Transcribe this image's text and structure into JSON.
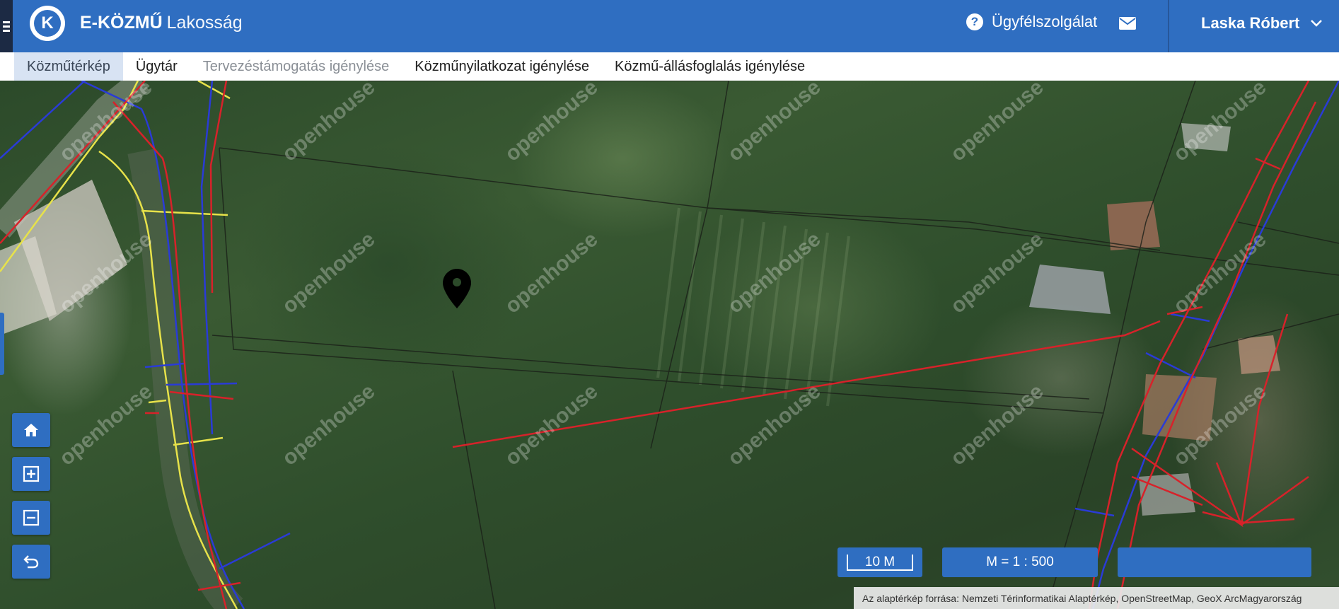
{
  "header": {
    "logo_letter": "K",
    "brand_strong": "E-KÖZMŰ",
    "brand_light": "Lakosság",
    "support_label": "Ügyfélszolgálat",
    "help_icon": "question-circle-icon",
    "mail_icon": "envelope-icon",
    "user_name": "Laska Róbert",
    "color_bg": "#2f6ec1"
  },
  "nav": {
    "items": [
      {
        "label": "Közműtérkép",
        "state": "active"
      },
      {
        "label": "Ügytár",
        "state": "normal"
      },
      {
        "label": "Tervezéstámogatás igénylése",
        "state": "disabled"
      },
      {
        "label": "Közműnyilatkozat igénylése",
        "state": "normal"
      },
      {
        "label": "Közmű-állásfoglalás igénylése",
        "state": "normal"
      }
    ]
  },
  "map": {
    "controls": [
      "home-icon",
      "zoom-in-icon",
      "zoom-out-icon",
      "undo-icon"
    ],
    "scale_bar_label": "10 M",
    "scale_ratio_label": "M = 1 : 500",
    "attribution": "Az alaptérkép forrása: Nemzeti Térinformatikai Alaptérkép, OpenStreetMap, GeoX ArcMagyarország",
    "watermark_text": "openhouse"
  }
}
